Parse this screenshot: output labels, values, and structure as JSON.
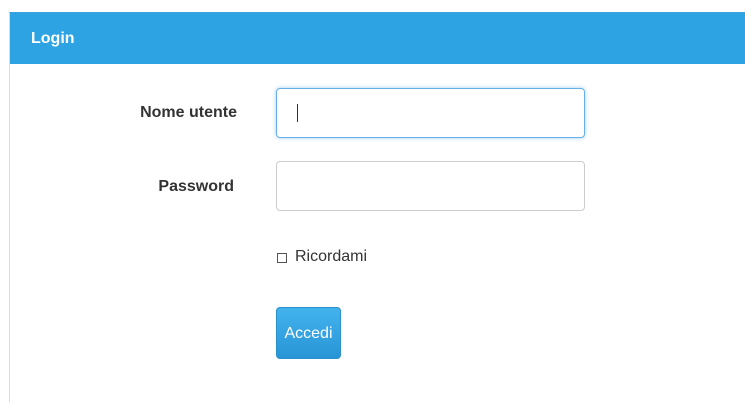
{
  "panel": {
    "title": "Login"
  },
  "form": {
    "username_label": "Nome utente",
    "username_value": "",
    "username_placeholder": "",
    "password_label": "Password",
    "password_value": "",
    "password_placeholder": "",
    "remember_label": "Ricordami",
    "remember_checked": false,
    "submit_label": "Accedi"
  },
  "colors": {
    "header_bg": "#2ea3e3",
    "button_bg": "#2895d6",
    "focus_border": "#66afe9"
  }
}
